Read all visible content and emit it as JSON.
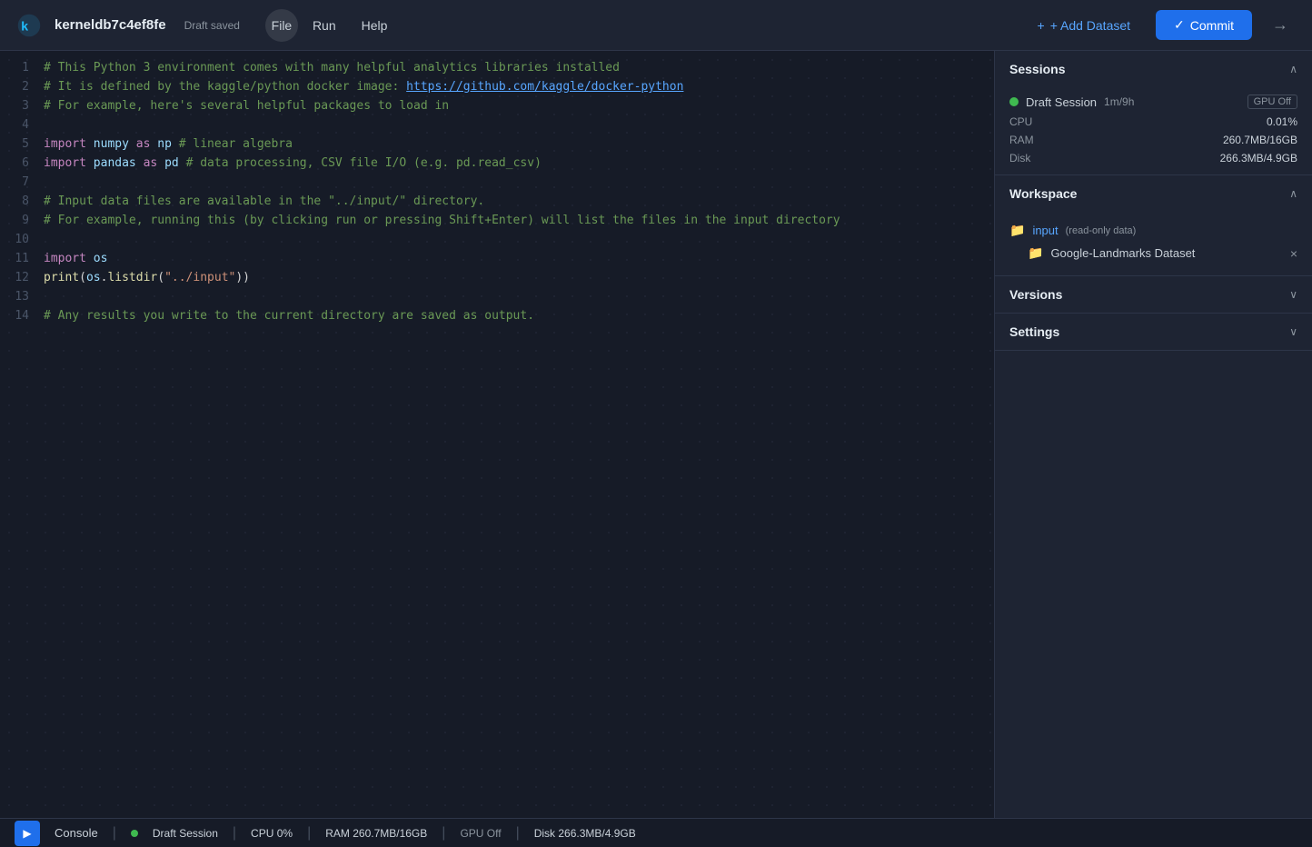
{
  "header": {
    "kernel_name": "kerneldb7c4ef8fe",
    "draft_status": "Draft saved",
    "nav_items": [
      {
        "label": "File",
        "id": "file"
      },
      {
        "label": "Run",
        "id": "run"
      },
      {
        "label": "Help",
        "id": "help"
      }
    ],
    "add_dataset_label": "+ Add Dataset",
    "commit_label": "Commit",
    "exit_icon": "→"
  },
  "code": {
    "lines": [
      {
        "num": 1,
        "content": "# This Python 3 environment comes with many helpful analytics libraries installed",
        "type": "comment"
      },
      {
        "num": 2,
        "content": "# It is defined by the kaggle/python docker image: https://github.com/kaggle/docker-python",
        "type": "comment"
      },
      {
        "num": 3,
        "content": "# For example, here's several helpful packages to load in",
        "type": "comment"
      },
      {
        "num": 4,
        "content": "",
        "type": "empty"
      },
      {
        "num": 5,
        "content": "import numpy as np # linear algebra",
        "type": "code"
      },
      {
        "num": 6,
        "content": "import pandas as pd # data processing, CSV file I/O (e.g. pd.read_csv)",
        "type": "code"
      },
      {
        "num": 7,
        "content": "",
        "type": "empty"
      },
      {
        "num": 8,
        "content": "# Input data files are available in the \"../input/\" directory.",
        "type": "comment"
      },
      {
        "num": 9,
        "content": "# For example, running this (by clicking run or pressing Shift+Enter) will list the files in the input directory",
        "type": "comment"
      },
      {
        "num": 10,
        "content": "",
        "type": "empty"
      },
      {
        "num": 11,
        "content": "import os",
        "type": "code"
      },
      {
        "num": 12,
        "content": "print(os.listdir(\"../input\"))",
        "type": "code"
      },
      {
        "num": 13,
        "content": "",
        "type": "empty"
      },
      {
        "num": 14,
        "content": "# Any results you write to the current directory are saved as output.",
        "type": "comment"
      }
    ]
  },
  "sidebar": {
    "sessions": {
      "title": "Sessions",
      "session_name": "Draft Session",
      "session_time": "1m/9h",
      "gpu_status": "GPU Off",
      "cpu_label": "CPU",
      "cpu_value": "0.01%",
      "ram_label": "RAM",
      "ram_value": "260.7MB/16GB",
      "disk_label": "Disk",
      "disk_value": "266.3MB/4.9GB"
    },
    "workspace": {
      "title": "Workspace",
      "input_label": "input",
      "input_badge": "(read-only data)",
      "dataset_name": "Google-Landmarks Dataset"
    },
    "versions": {
      "title": "Versions"
    },
    "settings": {
      "title": "Settings"
    }
  },
  "statusbar": {
    "run_icon": "▶",
    "console_label": "Console",
    "session_dot_color": "#3fb950",
    "session_label": "Draft Session",
    "cpu_label": "CPU 0%",
    "ram_label": "RAM 260.7MB/16GB",
    "gpu_label": "GPU Off",
    "disk_label": "Disk 266.3MB/4.9GB"
  },
  "icons": {
    "chevron_up": "∧",
    "chevron_down": "∨",
    "folder": "📁",
    "close": "×",
    "checkmark": "✓",
    "plus": "+",
    "arrow_right": "→"
  }
}
